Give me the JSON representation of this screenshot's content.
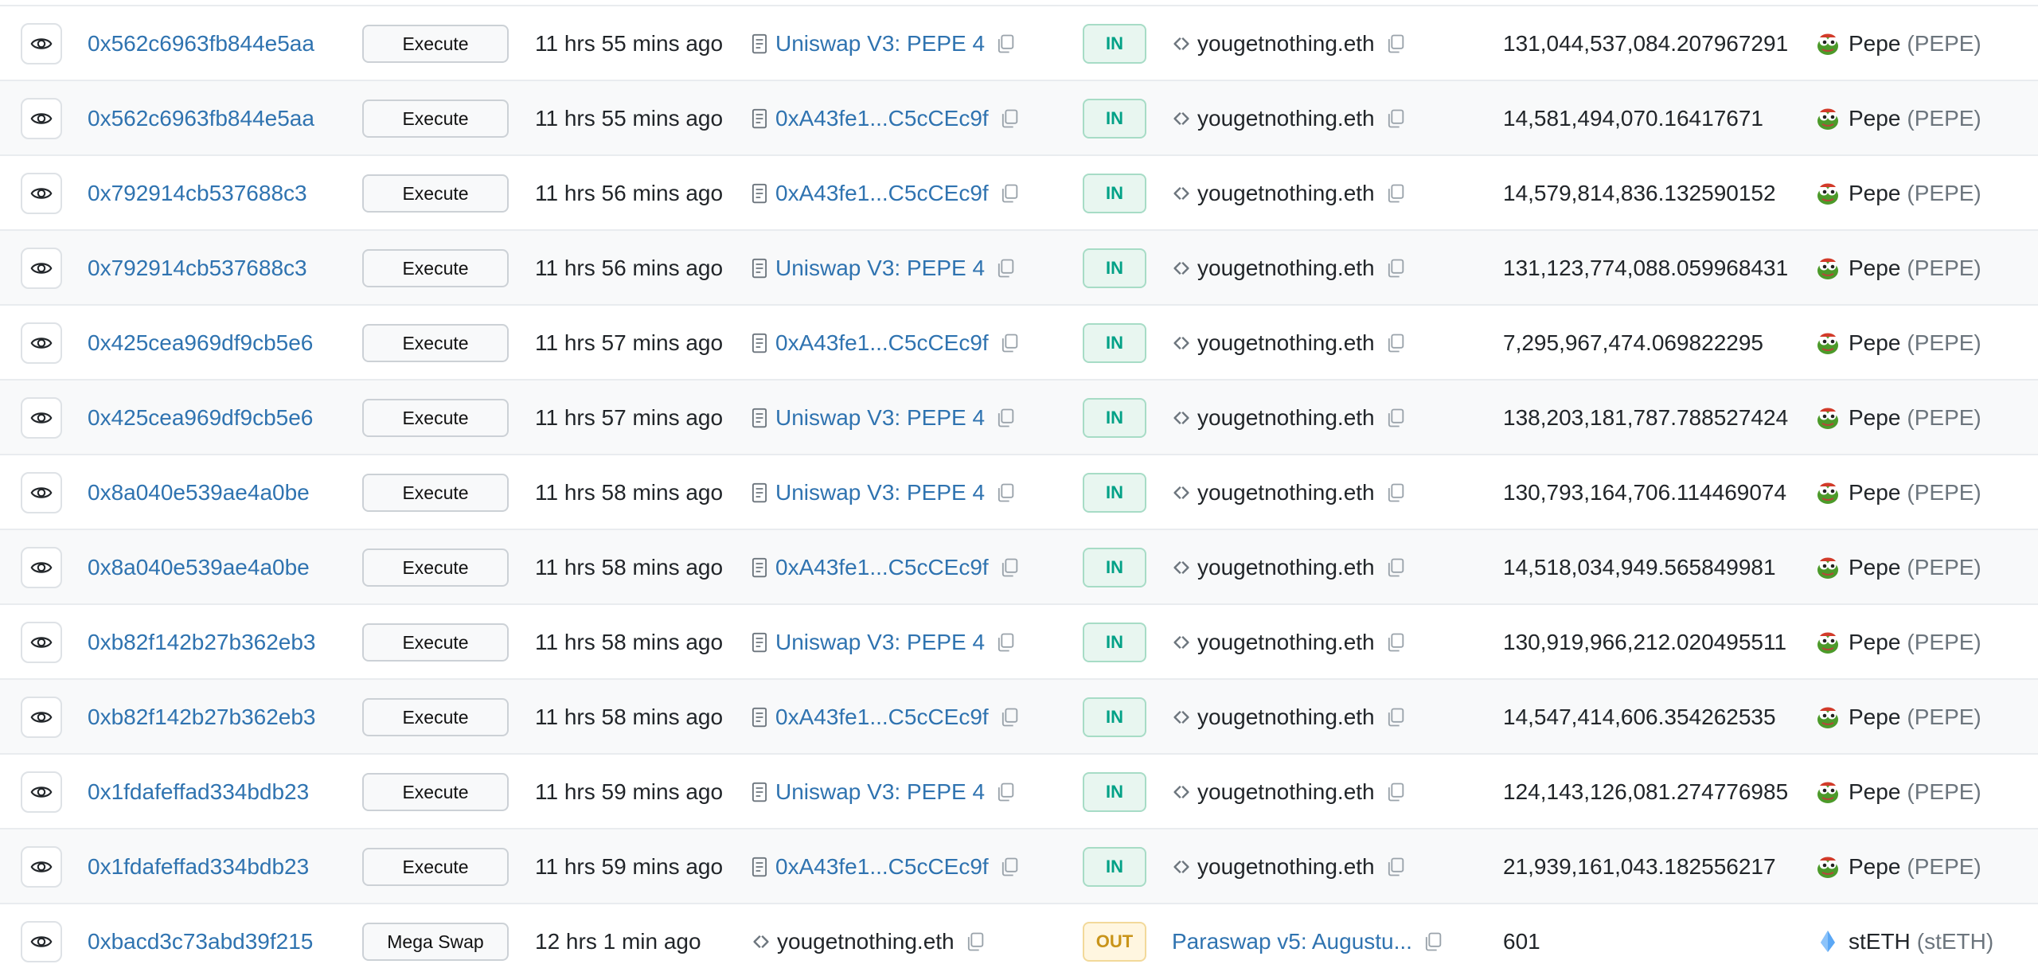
{
  "colors": {
    "link": "#2f73b0",
    "in_badge_text": "#00a186",
    "out_badge_text": "#c99419",
    "row_alt_bg": "#f8f9fa"
  },
  "rows": [
    {
      "hash": "0x562c6963fb844e5aa",
      "method": "Execute",
      "age": "11 hrs 55 mins ago",
      "from": "Uniswap V3: PEPE 4",
      "from_icon": "contract-doc-icon",
      "from_link": true,
      "dir": "IN",
      "to": "yougetnothing.eth",
      "to_icon": "code-icon",
      "to_link": false,
      "amount": "131,044,537,084.207967291",
      "token_name": "Pepe",
      "token_symbol": "(PEPE)",
      "token_icon": "pepe-token-icon"
    },
    {
      "hash": "0x562c6963fb844e5aa",
      "method": "Execute",
      "age": "11 hrs 55 mins ago",
      "from": "0xA43fe1...C5cCEc9f",
      "from_icon": "contract-doc-icon",
      "from_link": true,
      "dir": "IN",
      "to": "yougetnothing.eth",
      "to_icon": "code-icon",
      "to_link": false,
      "amount": "14,581,494,070.16417671",
      "token_name": "Pepe",
      "token_symbol": "(PEPE)",
      "token_icon": "pepe-token-icon"
    },
    {
      "hash": "0x792914cb537688c3",
      "method": "Execute",
      "age": "11 hrs 56 mins ago",
      "from": "0xA43fe1...C5cCEc9f",
      "from_icon": "contract-doc-icon",
      "from_link": true,
      "dir": "IN",
      "to": "yougetnothing.eth",
      "to_icon": "code-icon",
      "to_link": false,
      "amount": "14,579,814,836.132590152",
      "token_name": "Pepe",
      "token_symbol": "(PEPE)",
      "token_icon": "pepe-token-icon"
    },
    {
      "hash": "0x792914cb537688c3",
      "method": "Execute",
      "age": "11 hrs 56 mins ago",
      "from": "Uniswap V3: PEPE 4",
      "from_icon": "contract-doc-icon",
      "from_link": true,
      "dir": "IN",
      "to": "yougetnothing.eth",
      "to_icon": "code-icon",
      "to_link": false,
      "amount": "131,123,774,088.059968431",
      "token_name": "Pepe",
      "token_symbol": "(PEPE)",
      "token_icon": "pepe-token-icon"
    },
    {
      "hash": "0x425cea969df9cb5e6",
      "method": "Execute",
      "age": "11 hrs 57 mins ago",
      "from": "0xA43fe1...C5cCEc9f",
      "from_icon": "contract-doc-icon",
      "from_link": true,
      "dir": "IN",
      "to": "yougetnothing.eth",
      "to_icon": "code-icon",
      "to_link": false,
      "amount": "7,295,967,474.069822295",
      "token_name": "Pepe",
      "token_symbol": "(PEPE)",
      "token_icon": "pepe-token-icon"
    },
    {
      "hash": "0x425cea969df9cb5e6",
      "method": "Execute",
      "age": "11 hrs 57 mins ago",
      "from": "Uniswap V3: PEPE 4",
      "from_icon": "contract-doc-icon",
      "from_link": true,
      "dir": "IN",
      "to": "yougetnothing.eth",
      "to_icon": "code-icon",
      "to_link": false,
      "amount": "138,203,181,787.788527424",
      "token_name": "Pepe",
      "token_symbol": "(PEPE)",
      "token_icon": "pepe-token-icon"
    },
    {
      "hash": "0x8a040e539ae4a0be",
      "method": "Execute",
      "age": "11 hrs 58 mins ago",
      "from": "Uniswap V3: PEPE 4",
      "from_icon": "contract-doc-icon",
      "from_link": true,
      "dir": "IN",
      "to": "yougetnothing.eth",
      "to_icon": "code-icon",
      "to_link": false,
      "amount": "130,793,164,706.114469074",
      "token_name": "Pepe",
      "token_symbol": "(PEPE)",
      "token_icon": "pepe-token-icon"
    },
    {
      "hash": "0x8a040e539ae4a0be",
      "method": "Execute",
      "age": "11 hrs 58 mins ago",
      "from": "0xA43fe1...C5cCEc9f",
      "from_icon": "contract-doc-icon",
      "from_link": true,
      "dir": "IN",
      "to": "yougetnothing.eth",
      "to_icon": "code-icon",
      "to_link": false,
      "amount": "14,518,034,949.565849981",
      "token_name": "Pepe",
      "token_symbol": "(PEPE)",
      "token_icon": "pepe-token-icon"
    },
    {
      "hash": "0xb82f142b27b362eb3",
      "method": "Execute",
      "age": "11 hrs 58 mins ago",
      "from": "Uniswap V3: PEPE 4",
      "from_icon": "contract-doc-icon",
      "from_link": true,
      "dir": "IN",
      "to": "yougetnothing.eth",
      "to_icon": "code-icon",
      "to_link": false,
      "amount": "130,919,966,212.020495511",
      "token_name": "Pepe",
      "token_symbol": "(PEPE)",
      "token_icon": "pepe-token-icon"
    },
    {
      "hash": "0xb82f142b27b362eb3",
      "method": "Execute",
      "age": "11 hrs 58 mins ago",
      "from": "0xA43fe1...C5cCEc9f",
      "from_icon": "contract-doc-icon",
      "from_link": true,
      "dir": "IN",
      "to": "yougetnothing.eth",
      "to_icon": "code-icon",
      "to_link": false,
      "amount": "14,547,414,606.354262535",
      "token_name": "Pepe",
      "token_symbol": "(PEPE)",
      "token_icon": "pepe-token-icon"
    },
    {
      "hash": "0x1fdafeffad334bdb23",
      "method": "Execute",
      "age": "11 hrs 59 mins ago",
      "from": "Uniswap V3: PEPE 4",
      "from_icon": "contract-doc-icon",
      "from_link": true,
      "dir": "IN",
      "to": "yougetnothing.eth",
      "to_icon": "code-icon",
      "to_link": false,
      "amount": "124,143,126,081.274776985",
      "token_name": "Pepe",
      "token_symbol": "(PEPE)",
      "token_icon": "pepe-token-icon"
    },
    {
      "hash": "0x1fdafeffad334bdb23",
      "method": "Execute",
      "age": "11 hrs 59 mins ago",
      "from": "0xA43fe1...C5cCEc9f",
      "from_icon": "contract-doc-icon",
      "from_link": true,
      "dir": "IN",
      "to": "yougetnothing.eth",
      "to_icon": "code-icon",
      "to_link": false,
      "amount": "21,939,161,043.182556217",
      "token_name": "Pepe",
      "token_symbol": "(PEPE)",
      "token_icon": "pepe-token-icon"
    },
    {
      "hash": "0xbacd3c73abd39f215",
      "method": "Mega Swap",
      "age": "12 hrs 1 min ago",
      "from": "yougetnothing.eth",
      "from_icon": "code-icon",
      "from_link": false,
      "dir": "OUT",
      "to": "Paraswap v5: Augustu...",
      "to_icon": "none",
      "to_link": true,
      "amount": "601",
      "token_name": "stETH",
      "token_symbol": "(stETH)",
      "token_icon": "steth-token-icon"
    }
  ]
}
